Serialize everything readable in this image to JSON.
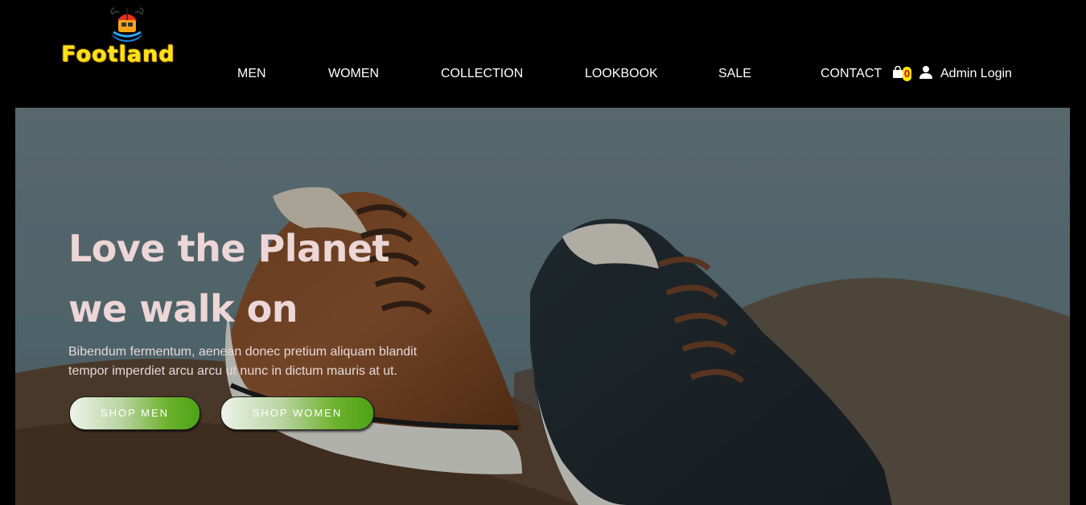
{
  "brand": {
    "name": "Footland",
    "logo_icon": "beach-umbrella-logo-icon"
  },
  "nav": {
    "items": [
      {
        "label": "MEN"
      },
      {
        "label": "WOMEN"
      },
      {
        "label": "COLLECTION"
      },
      {
        "label": "LOOKBOOK"
      },
      {
        "label": "SALE"
      },
      {
        "label": "CONTACT"
      }
    ],
    "cart_icon": "shopping-bag-icon",
    "cart_count": "0",
    "user_icon": "user-icon",
    "admin_label": "Admin Login"
  },
  "hero": {
    "title_line1": "Love the Planet",
    "title_line2": "we walk on",
    "text": "Bibendum fermentum, aenean donec pretium aliquam blandit tempor imperdiet arcu arcu ut nunc in dictum mauris at ut.",
    "buttons": [
      {
        "label": "SHOP MEN"
      },
      {
        "label": "SHOP WOMEN"
      }
    ]
  },
  "colors": {
    "header_bg": "#000000",
    "logo_yellow": "#ffe21a",
    "hero_title": "#ecd6d6",
    "button_green": "#4ca316",
    "cart_badge": "#ffe600"
  }
}
